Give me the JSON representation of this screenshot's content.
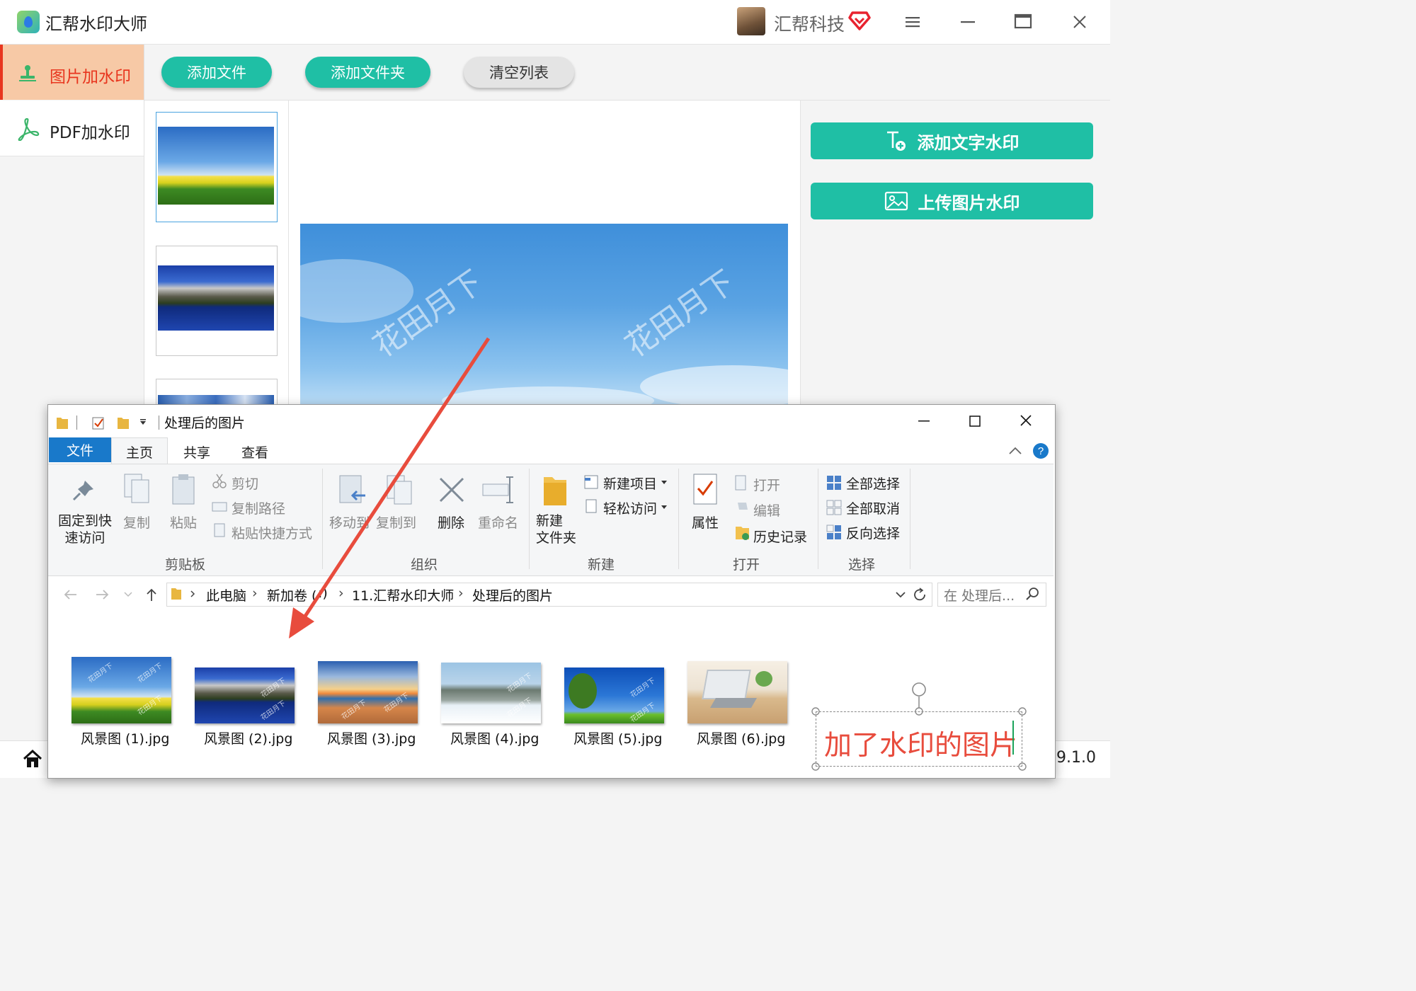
{
  "app": {
    "title": "汇帮水印大师",
    "user_name": "汇帮科技",
    "version": "9.1.0"
  },
  "sidebar": {
    "items": [
      {
        "label": "图片加水印",
        "active": true
      },
      {
        "label": "PDF加水印",
        "active": false
      }
    ]
  },
  "toolbar": {
    "add_file": "添加文件",
    "add_folder": "添加文件夹",
    "clear_list": "清空列表"
  },
  "right_panel": {
    "add_text_watermark": "添加文字水印",
    "upload_image_watermark": "上传图片水印"
  },
  "preview": {
    "watermark_text": "花田月下"
  },
  "explorer": {
    "title": "处理后的图片",
    "tabs": [
      "文件",
      "主页",
      "共享",
      "查看"
    ],
    "ribbon": {
      "clipboard": {
        "pin": "固定到快\n速访问",
        "copy": "复制",
        "paste": "粘贴",
        "cut": "剪切",
        "copy_path": "复制路径",
        "paste_shortcut": "粘贴快捷方式",
        "group": "剪贴板"
      },
      "organize": {
        "move_to": "移动到",
        "copy_to": "复制到",
        "delete": "删除",
        "rename": "重命名",
        "group": "组织"
      },
      "new": {
        "new_folder": "新建\n文件夹",
        "new_item": "新建项目",
        "easy_access": "轻松访问",
        "group": "新建"
      },
      "open": {
        "properties": "属性",
        "open": "打开",
        "edit": "编辑",
        "history": "历史记录",
        "group": "打开"
      },
      "select": {
        "select_all": "全部选择",
        "select_none": "全部取消",
        "invert": "反向选择",
        "group": "选择"
      }
    },
    "breadcrumb": [
      "此电脑",
      "新加卷 (",
      ":)",
      "11.汇帮水印大师",
      "处理后的图片"
    ],
    "search_placeholder": "在 处理后...",
    "files": [
      {
        "name": "风景图 (1).jpg"
      },
      {
        "name": "风景图 (2).jpg"
      },
      {
        "name": "风景图 (3).jpg"
      },
      {
        "name": "风景图 (4).jpg"
      },
      {
        "name": "风景图 (5).jpg"
      },
      {
        "name": "风景图 (6).jpg"
      }
    ]
  },
  "annotation": {
    "text": "加了水印的图片",
    "color": "#e84c3d"
  },
  "colors": {
    "accent": "#1fbfa5",
    "active_nav_bg": "#f7c9a6",
    "active_nav_text": "#e8361f",
    "explorer_file_tab": "#1979ca"
  }
}
